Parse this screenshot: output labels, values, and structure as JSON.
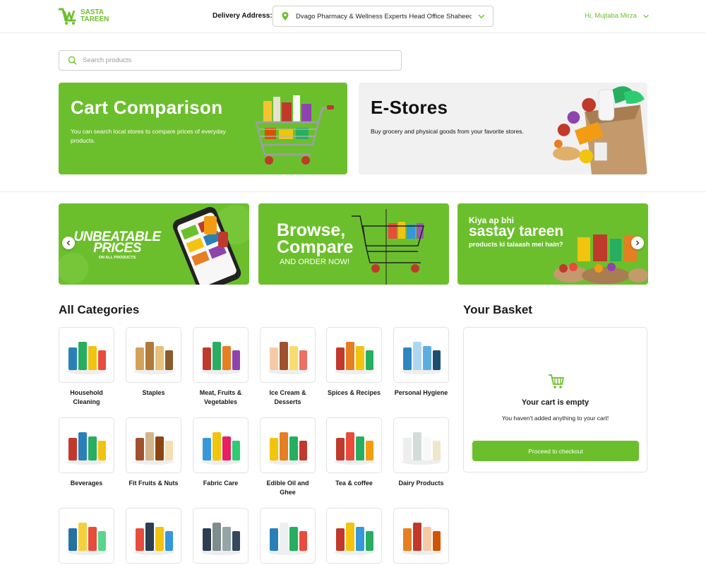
{
  "brand": {
    "line1": "SASTA",
    "line2": "TAREEN",
    "color": "#6cbf2c"
  },
  "header": {
    "delivery_label": "Delivery Address:",
    "address": "Dvago Pharmacy & Wellness Experts Head Office Shaheed...",
    "greeting": "Hi, Mujtaba Mirza"
  },
  "search": {
    "placeholder": "Search products"
  },
  "features": [
    {
      "title": "Cart Comparison",
      "description": "You can search local stores to compare prices of everyday products."
    },
    {
      "title": "E-Stores",
      "description": "Buy grocery and physical goods from your favorite stores."
    }
  ],
  "banners": {
    "b1": {
      "title_line1": "UNBEATABLE",
      "title_line2": "PRICES",
      "subtitle": "ON ALL PRODUCTS"
    },
    "b2": {
      "line1": "Browse,",
      "line2": "Compare",
      "line3": "AND ORDER NOW!"
    },
    "b3": {
      "line1": "Kiya ap bhi",
      "line2": "sastay tareen",
      "line3": "products ki talaash mei hain?"
    }
  },
  "categories_title": "All Categories",
  "categories": [
    {
      "label": "Household Cleaning",
      "icon": "cleaning-products-icon"
    },
    {
      "label": "Staples",
      "icon": "bread-basket-icon"
    },
    {
      "label": "Meat, Fruits & Vegetables",
      "icon": "vegetables-icon"
    },
    {
      "label": "Ice Cream & Desserts",
      "icon": "ice-cream-icon"
    },
    {
      "label": "Spices & Recipes",
      "icon": "spices-icon"
    },
    {
      "label": "Personal Hygiene",
      "icon": "hygiene-icon"
    },
    {
      "label": "Beverages",
      "icon": "beverages-icon"
    },
    {
      "label": "Fit Fruits & Nuts",
      "icon": "nuts-icon"
    },
    {
      "label": "Fabric Care",
      "icon": "detergent-icon"
    },
    {
      "label": "Edible Oil and Ghee",
      "icon": "oil-icon"
    },
    {
      "label": "Tea & coffee",
      "icon": "tea-icon"
    },
    {
      "label": "Dairy Products",
      "icon": "dairy-icon"
    },
    {
      "label": "",
      "icon": "pet-food-icon"
    },
    {
      "label": "",
      "icon": "stationery-icon"
    },
    {
      "label": "",
      "icon": "cookware-icon"
    },
    {
      "label": "",
      "icon": "pharmacy-icon"
    },
    {
      "label": "",
      "icon": "snacks-icon"
    },
    {
      "label": "",
      "icon": "baby-food-icon"
    }
  ],
  "basket": {
    "title": "Your Basket",
    "empty_title": "Your cart is empty",
    "empty_subtitle": "You haven't added anything to your cart!",
    "checkout_label": "Proceed to checkout"
  }
}
